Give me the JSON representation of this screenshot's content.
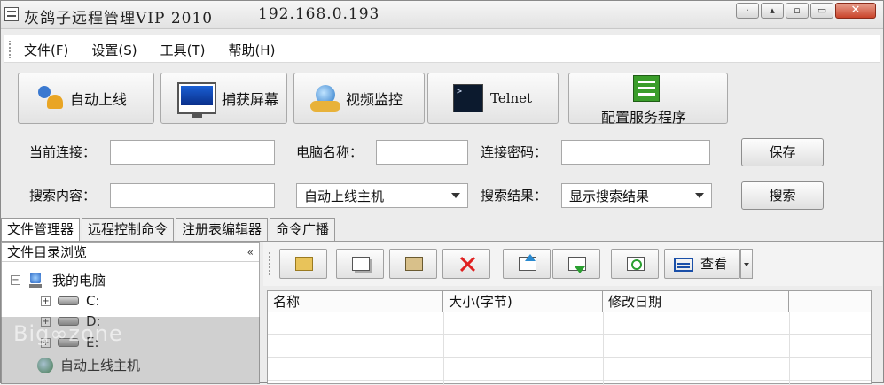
{
  "window": {
    "title": "灰鸽子远程管理VIP 2010",
    "ip": "192.168.0.193",
    "min_glyph": "▫",
    "restore_glyph": "▭",
    "close_glyph": "✕"
  },
  "menu": {
    "items": [
      {
        "label": "文件(F)"
      },
      {
        "label": "设置(S)"
      },
      {
        "label": "工具(T)"
      },
      {
        "label": "帮助(H)"
      }
    ]
  },
  "toolbar": {
    "auto_online": "自动上线",
    "capture_screen": "捕获屏幕",
    "video_monitor": "视频监控",
    "telnet": "Telnet",
    "config_server": "配置服务程序"
  },
  "connection": {
    "current_label": "当前连接：",
    "current_value": "",
    "computer_name_label": "电脑名称：",
    "computer_name_value": "",
    "password_label": "连接密码：",
    "password_value": "",
    "save_button": "保存"
  },
  "search": {
    "content_label": "搜索内容：",
    "content_value": "",
    "scope_selected": "自动上线主机",
    "result_label": "搜索结果：",
    "result_selected": "显示搜索结果",
    "search_button": "搜索"
  },
  "tabs": [
    {
      "label": "文件管理器",
      "active": true
    },
    {
      "label": "远程控制命令",
      "active": false
    },
    {
      "label": "注册表编辑器",
      "active": false
    },
    {
      "label": "命令广播",
      "active": false
    }
  ],
  "file_browser": {
    "title": "文件目录浏览",
    "collapse_glyph": "«",
    "tree": {
      "root_label": "我的电脑",
      "drives": [
        "C:",
        "D:",
        "E:"
      ],
      "auto_online_host": "自动上线主机"
    },
    "watermark": "Big∞zone"
  },
  "file_toolbar": {
    "view_label": "查看"
  },
  "file_list": {
    "columns": [
      "名称",
      "大小(字节)",
      "修改日期"
    ]
  }
}
